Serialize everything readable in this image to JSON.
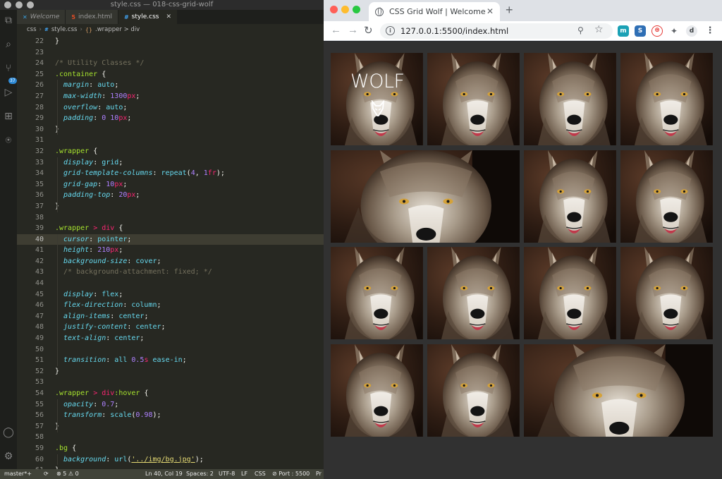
{
  "vscode": {
    "window_title": "style.css — 018-css-grid-wolf",
    "tabs": [
      {
        "label": "Welcome",
        "icon": "vscode-icon"
      },
      {
        "label": "index.html",
        "icon": "html5-icon"
      },
      {
        "label": "style.css",
        "icon": "css-icon",
        "active": true
      }
    ],
    "breadcrumb": [
      "css",
      "style.css",
      ".wrapper > div"
    ],
    "scm_badge": "37",
    "status": {
      "branch": "master*+",
      "problems": "⊗ 5 ⚠ 0",
      "position": "Ln 40, Col 19",
      "spaces": "Spaces: 2",
      "encoding": "UTF-8",
      "eol": "LF",
      "language": "CSS",
      "port": "⊘ Port : 5500",
      "extra": "Pr"
    },
    "code": [
      {
        "n": "22",
        "t": [
          [
            "}",
            "pun"
          ]
        ]
      },
      {
        "n": "23",
        "t": []
      },
      {
        "n": "24",
        "t": [
          [
            "/* Utility Classes */",
            "com"
          ]
        ]
      },
      {
        "n": "25",
        "t": [
          [
            ".container",
            "sel"
          ],
          [
            " {",
            "pun"
          ]
        ]
      },
      {
        "n": "26",
        "t": [
          [
            "  margin",
            "prop"
          ],
          [
            ": ",
            "pun"
          ],
          [
            "auto",
            "val"
          ],
          [
            ";",
            "pun"
          ]
        ]
      },
      {
        "n": "27",
        "t": [
          [
            "  max-width",
            "prop"
          ],
          [
            ": ",
            "pun"
          ],
          [
            "1300",
            "num"
          ],
          [
            "px",
            "unit"
          ],
          [
            ";",
            "pun"
          ]
        ]
      },
      {
        "n": "28",
        "t": [
          [
            "  overflow",
            "prop"
          ],
          [
            ": ",
            "pun"
          ],
          [
            "auto",
            "val"
          ],
          [
            ";",
            "pun"
          ]
        ]
      },
      {
        "n": "29",
        "t": [
          [
            "  padding",
            "prop"
          ],
          [
            ": ",
            "pun"
          ],
          [
            "0 10",
            "num"
          ],
          [
            "px",
            "unit"
          ],
          [
            ";",
            "pun"
          ]
        ]
      },
      {
        "n": "30",
        "t": [
          [
            "}",
            "pun"
          ]
        ]
      },
      {
        "n": "31",
        "t": []
      },
      {
        "n": "32",
        "t": [
          [
            ".wrapper",
            "sel"
          ],
          [
            " {",
            "pun"
          ]
        ]
      },
      {
        "n": "33",
        "t": [
          [
            "  display",
            "prop"
          ],
          [
            ": ",
            "pun"
          ],
          [
            "grid",
            "val"
          ],
          [
            ";",
            "pun"
          ]
        ]
      },
      {
        "n": "34",
        "t": [
          [
            "  grid-template-columns",
            "prop"
          ],
          [
            ": ",
            "pun"
          ],
          [
            "repeat",
            "val"
          ],
          [
            "(",
            "pun"
          ],
          [
            "4",
            "num"
          ],
          [
            ", ",
            "pun"
          ],
          [
            "1",
            "num"
          ],
          [
            "fr",
            "unit"
          ],
          [
            ");",
            "pun"
          ]
        ]
      },
      {
        "n": "35",
        "t": [
          [
            "  grid-gap",
            "prop"
          ],
          [
            ": ",
            "pun"
          ],
          [
            "10",
            "num"
          ],
          [
            "px",
            "unit"
          ],
          [
            ";",
            "pun"
          ]
        ]
      },
      {
        "n": "36",
        "t": [
          [
            "  padding-top",
            "prop"
          ],
          [
            ": ",
            "pun"
          ],
          [
            "20",
            "num"
          ],
          [
            "px",
            "unit"
          ],
          [
            ";",
            "pun"
          ]
        ]
      },
      {
        "n": "37",
        "t": [
          [
            "}",
            "pun"
          ]
        ]
      },
      {
        "n": "38",
        "t": []
      },
      {
        "n": "39",
        "t": [
          [
            ".wrapper",
            "sel"
          ],
          [
            " > ",
            "op"
          ],
          [
            "div",
            "op"
          ],
          [
            " {",
            "pun"
          ]
        ]
      },
      {
        "n": "40",
        "t": [
          [
            "  cursor",
            "prop"
          ],
          [
            ": ",
            "pun"
          ],
          [
            "pointer",
            "val"
          ],
          [
            ";",
            "pun"
          ]
        ],
        "current": true
      },
      {
        "n": "41",
        "t": [
          [
            "  height",
            "prop"
          ],
          [
            ": ",
            "pun"
          ],
          [
            "210",
            "num"
          ],
          [
            "px",
            "unit"
          ],
          [
            ";",
            "pun"
          ]
        ]
      },
      {
        "n": "42",
        "t": [
          [
            "  background-size",
            "prop"
          ],
          [
            ": ",
            "pun"
          ],
          [
            "cover",
            "val"
          ],
          [
            ";",
            "pun"
          ]
        ]
      },
      {
        "n": "43",
        "t": [
          [
            "  /* background-attachment: fixed; */",
            "com"
          ]
        ]
      },
      {
        "n": "44",
        "t": []
      },
      {
        "n": "45",
        "t": [
          [
            "  display",
            "prop"
          ],
          [
            ": ",
            "pun"
          ],
          [
            "flex",
            "val"
          ],
          [
            ";",
            "pun"
          ]
        ]
      },
      {
        "n": "46",
        "t": [
          [
            "  flex-direction",
            "prop"
          ],
          [
            ": ",
            "pun"
          ],
          [
            "column",
            "val"
          ],
          [
            ";",
            "pun"
          ]
        ]
      },
      {
        "n": "47",
        "t": [
          [
            "  align-items",
            "prop"
          ],
          [
            ": ",
            "pun"
          ],
          [
            "center",
            "val"
          ],
          [
            ";",
            "pun"
          ]
        ]
      },
      {
        "n": "48",
        "t": [
          [
            "  justify-content",
            "prop"
          ],
          [
            ": ",
            "pun"
          ],
          [
            "center",
            "val"
          ],
          [
            ";",
            "pun"
          ]
        ]
      },
      {
        "n": "49",
        "t": [
          [
            "  text-align",
            "prop"
          ],
          [
            ": ",
            "pun"
          ],
          [
            "center",
            "val"
          ],
          [
            ";",
            "pun"
          ]
        ]
      },
      {
        "n": "50",
        "t": []
      },
      {
        "n": "51",
        "t": [
          [
            "  transition",
            "prop"
          ],
          [
            ": ",
            "pun"
          ],
          [
            "all ",
            "val"
          ],
          [
            "0.5",
            "num"
          ],
          [
            "s",
            "unit"
          ],
          [
            " ease-in",
            "val"
          ],
          [
            ";",
            "pun"
          ]
        ]
      },
      {
        "n": "52",
        "t": [
          [
            "}",
            "pun"
          ]
        ]
      },
      {
        "n": "53",
        "t": []
      },
      {
        "n": "54",
        "t": [
          [
            ".wrapper",
            "sel"
          ],
          [
            " > ",
            "op"
          ],
          [
            "div",
            "op"
          ],
          [
            ":hover",
            "sel"
          ],
          [
            " {",
            "pun"
          ]
        ]
      },
      {
        "n": "55",
        "t": [
          [
            "  opacity",
            "prop"
          ],
          [
            ": ",
            "pun"
          ],
          [
            "0.7",
            "num"
          ],
          [
            ";",
            "pun"
          ]
        ]
      },
      {
        "n": "56",
        "t": [
          [
            "  transform",
            "prop"
          ],
          [
            ": ",
            "pun"
          ],
          [
            "scale",
            "val"
          ],
          [
            "(",
            "pun"
          ],
          [
            "0.98",
            "num"
          ],
          [
            ");",
            "pun"
          ]
        ]
      },
      {
        "n": "57",
        "t": [
          [
            "}",
            "pun"
          ]
        ]
      },
      {
        "n": "58",
        "t": []
      },
      {
        "n": "59",
        "t": [
          [
            ".bg",
            "sel"
          ],
          [
            " {",
            "pun"
          ]
        ]
      },
      {
        "n": "60",
        "t": [
          [
            "  background",
            "prop"
          ],
          [
            ": ",
            "pun"
          ],
          [
            "url",
            "val"
          ],
          [
            "(",
            "pun"
          ],
          [
            "'../img/bg.jpg'",
            "str"
          ],
          [
            ");",
            "pun"
          ]
        ]
      },
      {
        "n": "61",
        "t": [
          [
            "}",
            "pun"
          ]
        ]
      }
    ]
  },
  "browser": {
    "tab_title": "CSS Grid Wolf | Welcome",
    "url": "127.0.0.1:5500/index.html",
    "page": {
      "title": "WOLF",
      "cells": [
        {
          "wide": false,
          "hero": true
        },
        {
          "wide": false
        },
        {
          "wide": false
        },
        {
          "wide": false
        },
        {
          "wide": true
        },
        {
          "wide": false
        },
        {
          "wide": false
        },
        {
          "wide": false
        },
        {
          "wide": false
        },
        {
          "wide": false
        },
        {
          "wide": false
        },
        {
          "wide": false
        },
        {
          "wide": false
        },
        {
          "wide": true
        }
      ]
    },
    "extensions": [
      {
        "name": "m-extension-icon",
        "label": "m",
        "color": "#1ba1b5"
      },
      {
        "name": "s-extension-icon",
        "label": "S",
        "color": "#2f6fb5"
      },
      {
        "name": "red-extension-icon",
        "label": "⊛",
        "color": "#e53935"
      },
      {
        "name": "puzzle-extension-icon",
        "label": "✦",
        "color": "#5f6368"
      },
      {
        "name": "profile-extension-icon",
        "label": "d",
        "color": "#3c4043"
      }
    ]
  }
}
